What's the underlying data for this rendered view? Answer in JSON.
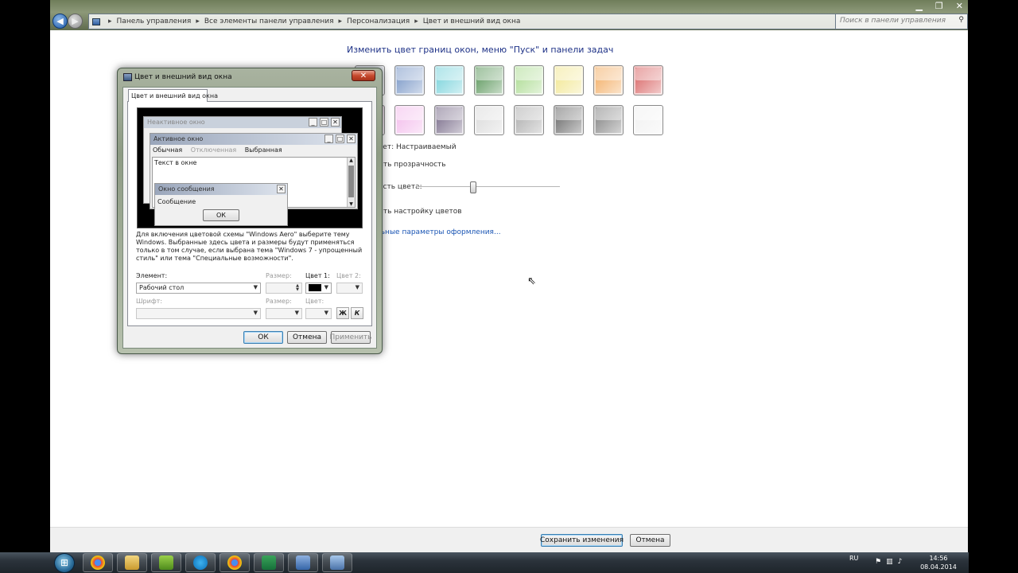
{
  "window": {
    "breadcrumb": [
      "Панель управления",
      "Все элементы панели управления",
      "Персонализация",
      "Цвет и внешний вид окна"
    ],
    "search_placeholder": "Поиск в панели управления",
    "controls": [
      "▁",
      "❐",
      "✕"
    ]
  },
  "main": {
    "heading": "Изменить цвет границ окон, меню \"Пуск\" и панели задач",
    "swatch_colors_row1": [
      "#b9c3d2",
      "#6f8fc2",
      "#6ecfd8",
      "#4f8f4f",
      "#a6d98a",
      "#f1e58a",
      "#f2a85a",
      "#d65a5a"
    ],
    "swatch_colors_row2": [
      "#b07aa8",
      "#f2b7ea",
      "#6e6080",
      "#d8d8d8",
      "#a8a8a8",
      "#5e5e5e",
      "#7a7a7a",
      "#f0f0f0"
    ],
    "color_label": "вет: Настраиваемый",
    "transparency_label": "ить прозрачность",
    "intensity_label": "ость цвета:",
    "mixer_label": "ить настройку цветов",
    "advanced_link": "льные параметры оформления...",
    "save_button": "Сохранить изменения",
    "cancel_button": "Отмена"
  },
  "dialog": {
    "title": "Цвет и внешний вид окна",
    "tab": "Цвет и внешний вид окна",
    "preview": {
      "inactive_title": "Неактивное окно",
      "active_title": "Активное окно",
      "menu": [
        "Обычная",
        "Отключенная",
        "Выбранная"
      ],
      "window_text": "Текст в окне",
      "msgbox_title": "Окно сообщения",
      "msgbox_text": "Сообщение",
      "msgbox_ok": "ОК"
    },
    "description": "Для включения цветовой схемы \"Windows Aero\" выберите тему Windows. Выбранные здесь цвета и размеры будут применяться только в том случае, если выбрана тема \"Windows 7 - упрощенный стиль\" или тема \"Специальные возможности\".",
    "element_label": "Элемент:",
    "element_value": "Рабочий стол",
    "size_label": "Размер:",
    "color1_label": "Цвет 1:",
    "color2_label": "Цвет 2:",
    "font_label": "Шрифт:",
    "font_size_label": "Размер:",
    "font_color_label": "Цвет:",
    "bold_btn": "Ж",
    "italic_btn": "К",
    "ok": "ОК",
    "cancel": "Отмена",
    "apply": "Применить"
  },
  "taskbar": {
    "lang": "RU",
    "time": "14:56",
    "date": "08.04.2014",
    "apps": [
      "chrome-icon",
      "explorer-icon",
      "utorrent-icon",
      "skype-icon",
      "chrome-icon",
      "excel-icon",
      "control-panel-icon",
      "display-settings-icon"
    ]
  }
}
